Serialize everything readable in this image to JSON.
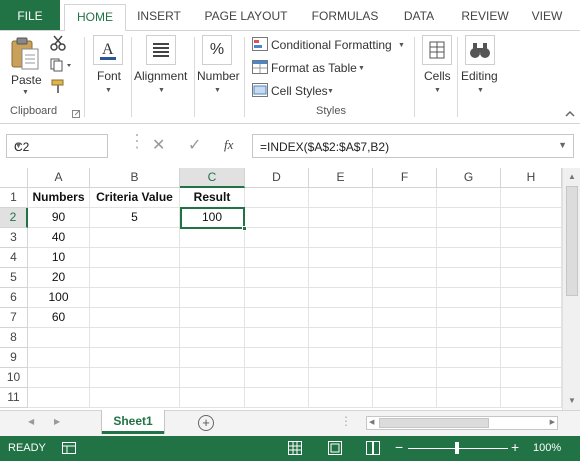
{
  "ribbon_tabs": [
    "FILE",
    "HOME",
    "INSERT",
    "PAGE LAYOUT",
    "FORMULAS",
    "DATA",
    "REVIEW",
    "VIEW"
  ],
  "groups": {
    "clipboard": {
      "paste": "Paste",
      "label": "Clipboard"
    },
    "font": {
      "label": "Font"
    },
    "alignment": {
      "label": "Alignment"
    },
    "number": {
      "label": "Number",
      "symbol": "%"
    },
    "styles": {
      "conditional": "Conditional Formatting",
      "format_table": "Format as Table",
      "cell_styles": "Cell Styles",
      "label": "Styles"
    },
    "cells": {
      "label": "Cells"
    },
    "editing": {
      "label": "Editing"
    }
  },
  "formula_bar": {
    "name_box": "C2",
    "fx": "fx",
    "formula": "=INDEX($A$2:$A$7,B2)"
  },
  "columns": [
    "A",
    "B",
    "C",
    "D",
    "E",
    "F",
    "G",
    "H"
  ],
  "rows": [
    "1",
    "2",
    "3",
    "4",
    "5",
    "6",
    "7",
    "8",
    "9",
    "10",
    "11"
  ],
  "cells": {
    "A1": "Numbers",
    "B1": "Criteria Value",
    "C1": "Result",
    "A2": "90",
    "B2": "5",
    "C2": "100",
    "A3": "40",
    "A4": "10",
    "A5": "20",
    "A6": "100",
    "A7": "60"
  },
  "sheet": {
    "tab_name": "Sheet1",
    "add": "+"
  },
  "status": {
    "ready": "READY",
    "zoom": "100%"
  },
  "colors": {
    "accent": "#217346"
  }
}
